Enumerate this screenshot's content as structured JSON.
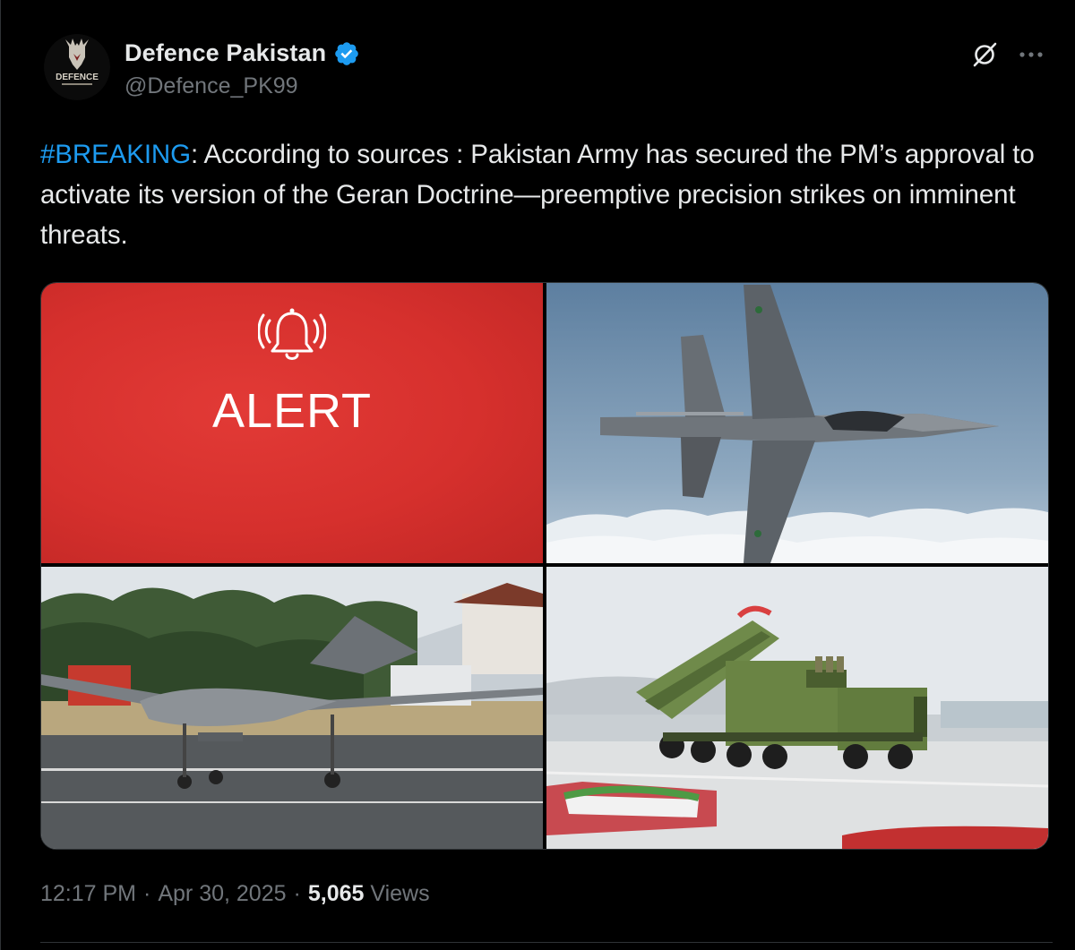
{
  "author": {
    "display_name": "Defence Pakistan",
    "handle": "@Defence_PK99",
    "avatar_text": "DEFENCE",
    "verified": true
  },
  "tweet": {
    "hashtag": "#BREAKING",
    "text": ": According to sources : Pakistan Army has secured the PM’s approval to activate its version of the Geran Doctrine—preemptive precision strikes on imminent threats."
  },
  "media": {
    "alert_label": "ALERT",
    "images": [
      "alert-graphic",
      "fighter-jet",
      "combat-drone",
      "missile-launcher-truck"
    ]
  },
  "footer": {
    "time": "12:17 PM",
    "sep1": "·",
    "date": "Apr 30, 2025",
    "sep2": "·",
    "views_count": "5,065",
    "views_label": "Views"
  },
  "colors": {
    "background": "#000000",
    "text": "#e7e9ea",
    "muted": "#71767b",
    "accent": "#1d9bf0",
    "alert_red": "#d6302d"
  },
  "icons": {
    "grok": "grok-icon",
    "more": "more-icon",
    "verified": "verified-badge-icon",
    "bell": "bell-icon"
  }
}
